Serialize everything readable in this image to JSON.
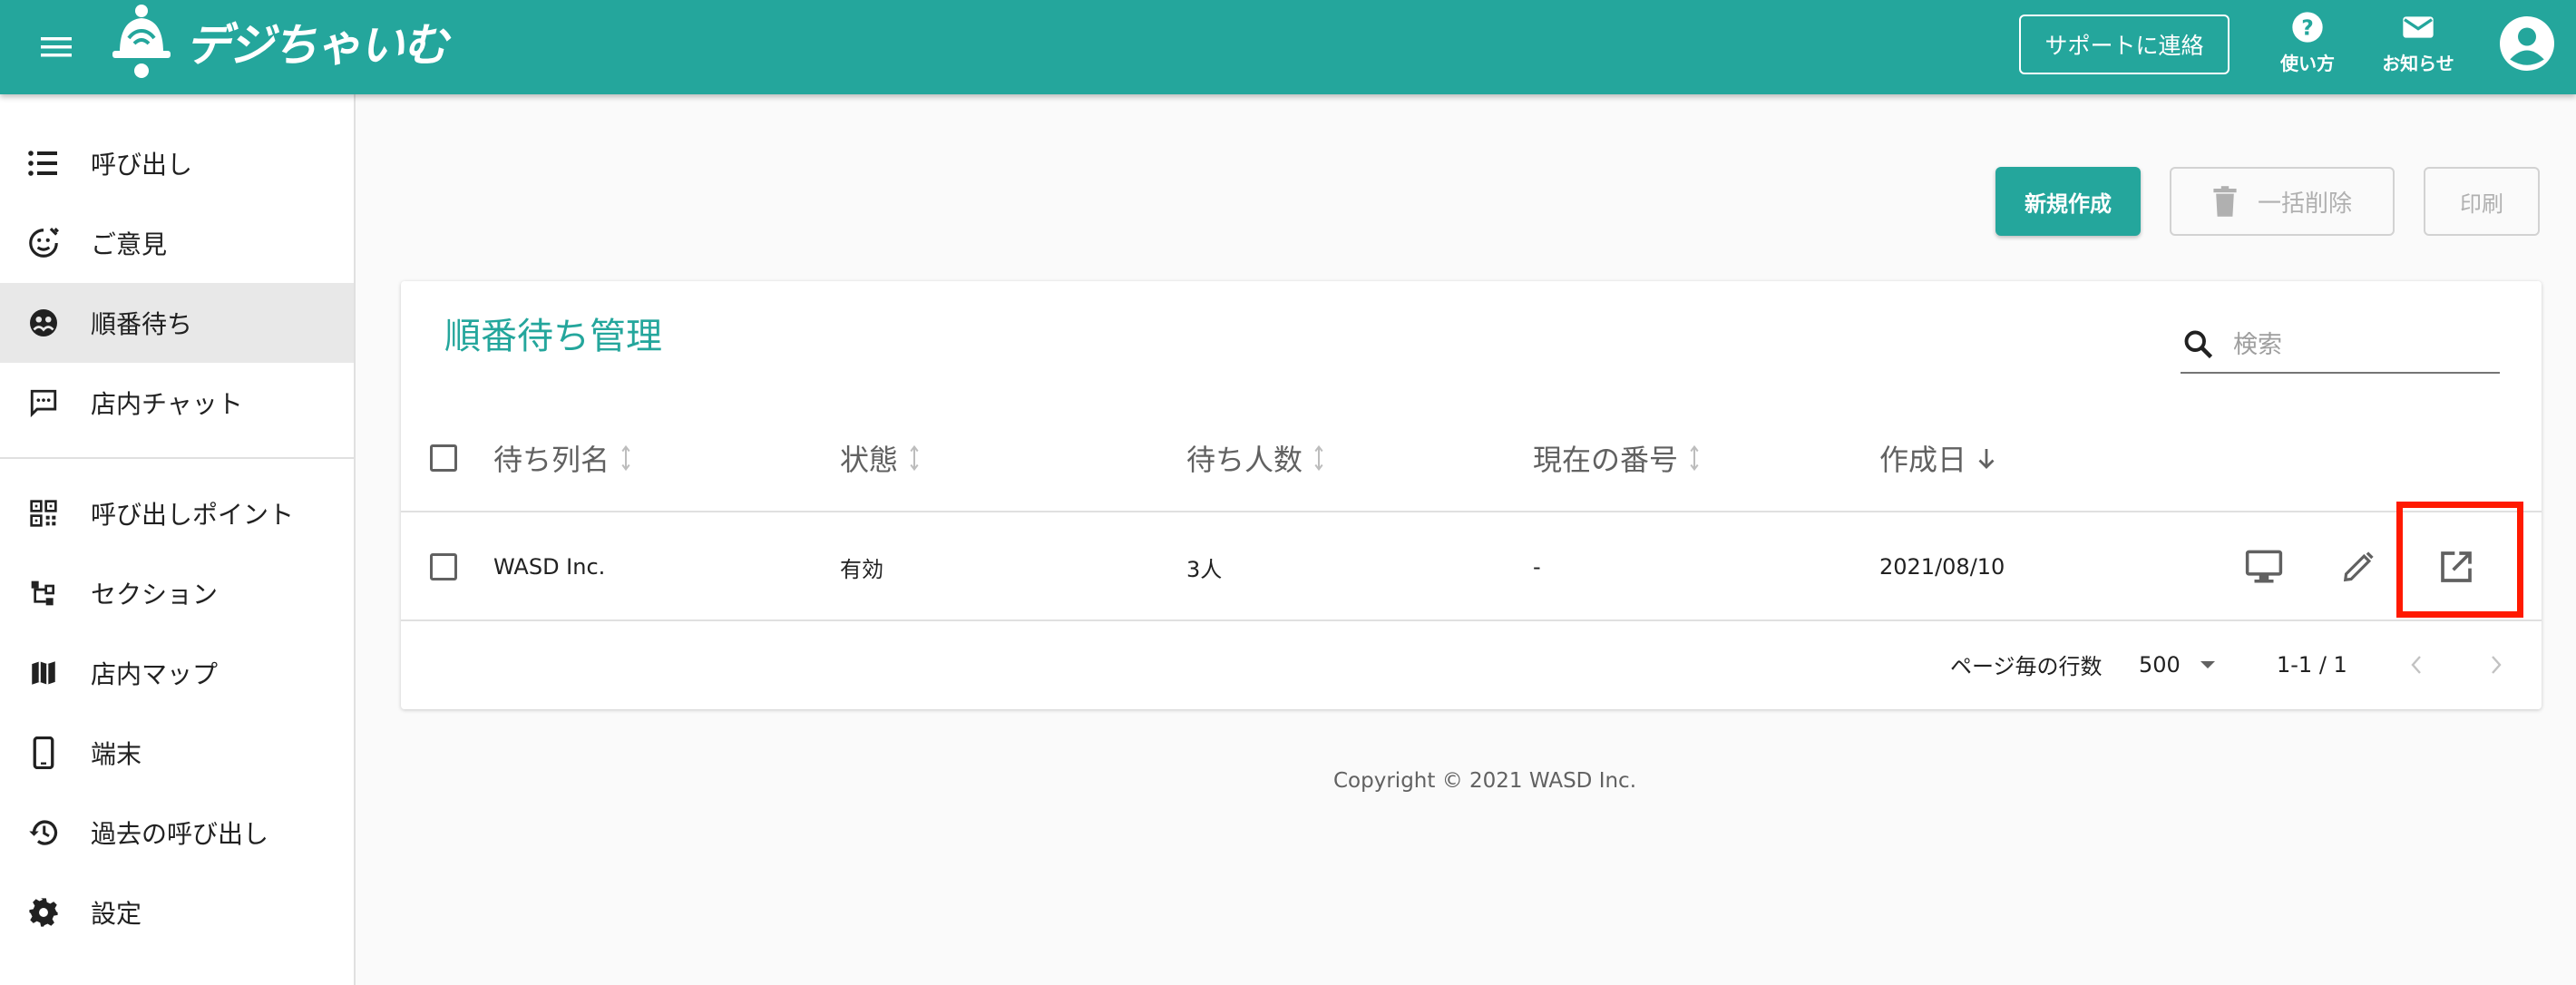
{
  "header": {
    "app_name": "デジちゃいむ",
    "support_label": "サポートに連絡",
    "help_label": "使い方",
    "notice_label": "お知らせ",
    "brand_color": "#24a69c",
    "icons": [
      "menu-icon",
      "bell-logo-icon",
      "help-icon",
      "mail-icon",
      "account-icon"
    ]
  },
  "sidebar": {
    "items": [
      {
        "label": "呼び出し",
        "icon": "list-icon"
      },
      {
        "label": "ご意見",
        "icon": "feedback-icon"
      },
      {
        "label": "順番待ち",
        "icon": "queue-icon",
        "active": true
      },
      {
        "label": "店内チャット",
        "icon": "chat-icon"
      },
      {
        "label": "呼び出しポイント",
        "icon": "qr-code-icon"
      },
      {
        "label": "セクション",
        "icon": "section-icon"
      },
      {
        "label": "店内マップ",
        "icon": "map-icon"
      },
      {
        "label": "端末",
        "icon": "phone-icon"
      },
      {
        "label": "過去の呼び出し",
        "icon": "history-icon"
      },
      {
        "label": "設定",
        "icon": "gear-icon"
      }
    ]
  },
  "toolbar": {
    "create_label": "新規作成",
    "bulk_delete_label": "一括削除",
    "print_label": "印刷"
  },
  "card": {
    "title": "順番待ち管理",
    "search_placeholder": "検索"
  },
  "table": {
    "columns": [
      "待ち列名",
      "状態",
      "待ち人数",
      "現在の番号",
      "作成日"
    ],
    "rows": [
      {
        "name": "WASD Inc.",
        "status": "有効",
        "waiting": "3人",
        "current_number": "-",
        "created": "2021/08/10"
      }
    ],
    "rows_per_page_label": "ページ毎の行数",
    "rows_per_page": "500",
    "range": "1-1 / 1"
  },
  "footer": {
    "copyright": "Copyright © 2021 WASD Inc."
  },
  "highlight_color": "#ff1a00"
}
